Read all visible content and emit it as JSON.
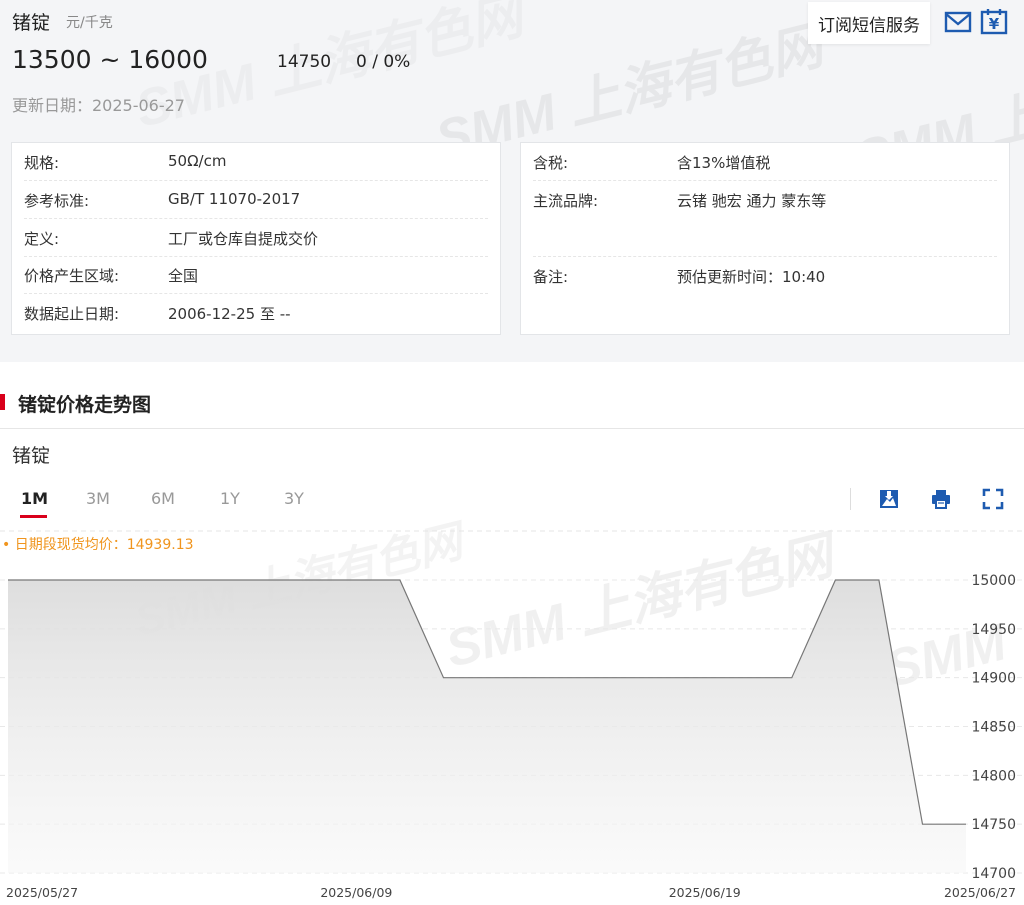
{
  "product": {
    "name": "锗锭",
    "unit": "元/千克",
    "price_range": "13500 ~ 16000",
    "latest_price": "14750",
    "change": "0 / 0%",
    "update_date": "更新日期：2025-06-27"
  },
  "subscribe_label": "订阅短信服务",
  "specs_left": [
    {
      "key": "规格:",
      "value": "50Ω/cm"
    },
    {
      "key": "参考标准:",
      "value": "GB/T 11070-2017"
    },
    {
      "key": "定义:",
      "value": "工厂或仓库自提成交价"
    },
    {
      "key": "价格产生区域:",
      "value": "全国"
    },
    {
      "key": "数据起止日期:",
      "value": "2006-12-25 至 --"
    }
  ],
  "specs_right": [
    {
      "key": "含税:",
      "value": "含13%增值税"
    },
    {
      "key": "主流品牌:",
      "value": "云锗 驰宏 通力 蒙东等"
    },
    {
      "key": "备注:",
      "value": "预估更新时间：10:40"
    }
  ],
  "section_title": "锗锭价格走势图",
  "chart_name": "锗锭",
  "tabs": [
    "1M",
    "3M",
    "6M",
    "1Y",
    "3Y"
  ],
  "active_tab": "1M",
  "average_label": "• 日期段现货均价：14939.13",
  "watermark": "SMM 上海有色网",
  "icons": {
    "mail": "mail-icon",
    "yen_calendar": "yen-calendar-icon",
    "download": "download-image-icon",
    "print": "print-icon",
    "fullscreen": "fullscreen-icon"
  },
  "colors": {
    "accent_red": "#d9001b",
    "icon_blue": "#1e5bb0",
    "average_orange": "#f0951e",
    "line_grey": "#777777"
  },
  "chart_data": {
    "type": "area",
    "title": "",
    "xlabel": "",
    "ylabel": "",
    "x_ticks": [
      "2025/05/27",
      "2025/06/09",
      "2025/06/19",
      "2025/06/27"
    ],
    "y_ticks": [
      14700,
      14750,
      14800,
      14850,
      14900,
      14950,
      15000
    ],
    "ylim": [
      14700,
      15000
    ],
    "grid": "horizontal dashed",
    "series": [
      {
        "x": [
          "2025-05-27",
          "2025-05-28",
          "2025-05-29",
          "2025-05-30",
          "2025-06-03",
          "2025-06-04",
          "2025-06-05",
          "2025-06-06",
          "2025-06-09",
          "2025-06-10",
          "2025-06-11",
          "2025-06-12",
          "2025-06-13",
          "2025-06-16",
          "2025-06-17",
          "2025-06-18",
          "2025-06-19",
          "2025-06-20",
          "2025-06-23",
          "2025-06-24",
          "2025-06-25",
          "2025-06-26",
          "2025-06-27"
        ],
        "values": [
          15000,
          15000,
          15000,
          15000,
          15000,
          15000,
          15000,
          15000,
          15000,
          15000,
          14900,
          14900,
          14900,
          14900,
          14900,
          14900,
          14900,
          14900,
          14900,
          15000,
          15000,
          14750,
          14750
        ]
      }
    ]
  }
}
